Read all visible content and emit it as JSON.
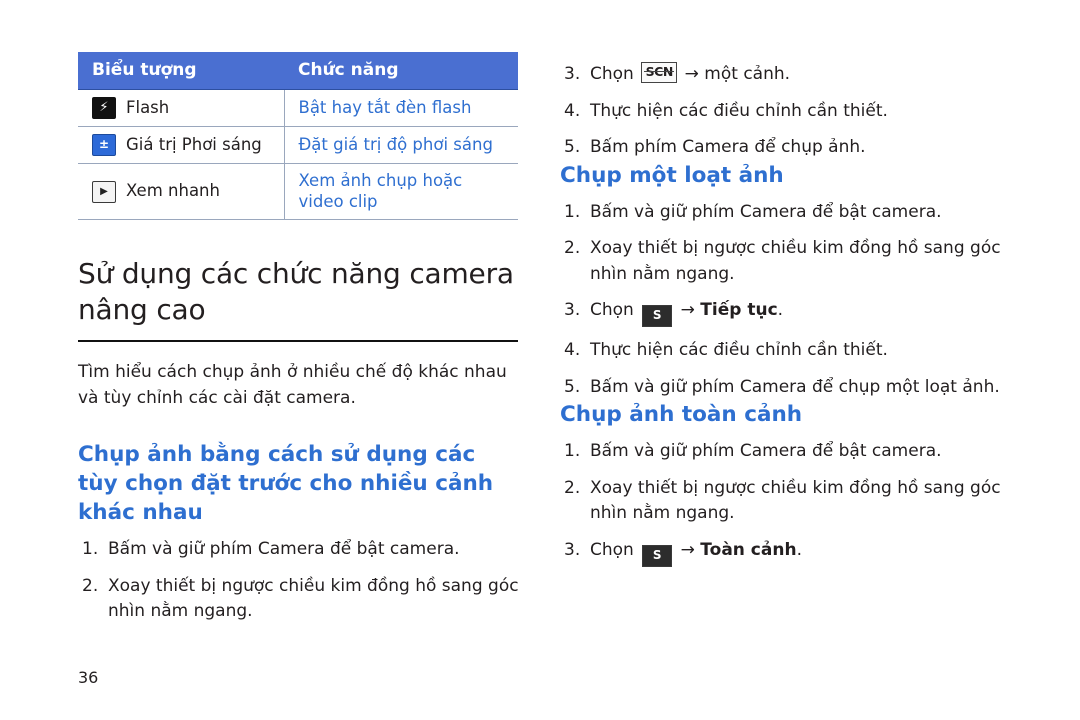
{
  "table": {
    "headers": [
      "Biểu tượng",
      "Chức năng"
    ],
    "rows": [
      {
        "icon": "flash-icon",
        "glyph": "⚡",
        "label": "Flash",
        "function": "Bật hay tắt đèn flash"
      },
      {
        "icon": "exposure-icon",
        "glyph": "±",
        "label": "Giá trị Phơi sáng",
        "function": "Đặt giá trị độ phơi sáng"
      },
      {
        "icon": "quick-view-icon",
        "glyph": "▶",
        "label": "Xem nhanh",
        "function": "Xem ảnh chụp hoặc video clip"
      }
    ]
  },
  "left": {
    "section_title": "Sử dụng các chức năng camera nâng cao",
    "intro": "Tìm hiểu cách chụp ảnh ở nhiều chế độ khác nhau và tùy chỉnh các cài đặt camera.",
    "subsection_title": "Chụp ảnh bằng cách sử dụng các tùy chọn đặt trước cho nhiều cảnh khác nhau",
    "steps": [
      {
        "num": "1.",
        "text": "Bấm và giữ phím Camera để bật camera."
      },
      {
        "num": "2.",
        "text": "Xoay thiết bị ngược chiều kim đồng hồ sang góc nhìn nằm ngang."
      }
    ]
  },
  "right": {
    "steps_top": [
      {
        "num": "3.",
        "pre": "Chọn ",
        "icon": "SCN",
        "post": " → một cảnh."
      },
      {
        "num": "4.",
        "text": "Thực hiện các điều chỉnh cần thiết."
      },
      {
        "num": "5.",
        "text": "Bấm phím Camera để chụp ảnh."
      }
    ],
    "burst_title": "Chụp một loạt ảnh",
    "burst_steps": [
      {
        "num": "1.",
        "text": "Bấm và giữ phím Camera để bật camera."
      },
      {
        "num": "2.",
        "text": "Xoay thiết bị ngược chiều kim đồng hồ sang góc nhìn nằm ngang."
      },
      {
        "num": "3.",
        "pre": "Chọn ",
        "icon": "S",
        "post": " → ",
        "bold": "Tiếp tục",
        "tail": "."
      },
      {
        "num": "4.",
        "text": "Thực hiện các điều chỉnh cần thiết."
      },
      {
        "num": "5.",
        "text": "Bấm và giữ phím Camera để chụp một loạt ảnh."
      }
    ],
    "pano_title": "Chụp ảnh toàn cảnh",
    "pano_steps": [
      {
        "num": "1.",
        "text": "Bấm và giữ phím Camera để bật camera."
      },
      {
        "num": "2.",
        "text": "Xoay thiết bị ngược chiều kim đồng hồ sang góc nhìn nằm ngang."
      },
      {
        "num": "3.",
        "pre": "Chọn ",
        "icon": "S",
        "post": " → ",
        "bold": "Toàn cảnh",
        "tail": "."
      }
    ]
  },
  "page_number": "36",
  "colors": {
    "header_blue": "#4a6fd1",
    "link_blue": "#2f6fd0",
    "text": "#231f20"
  }
}
